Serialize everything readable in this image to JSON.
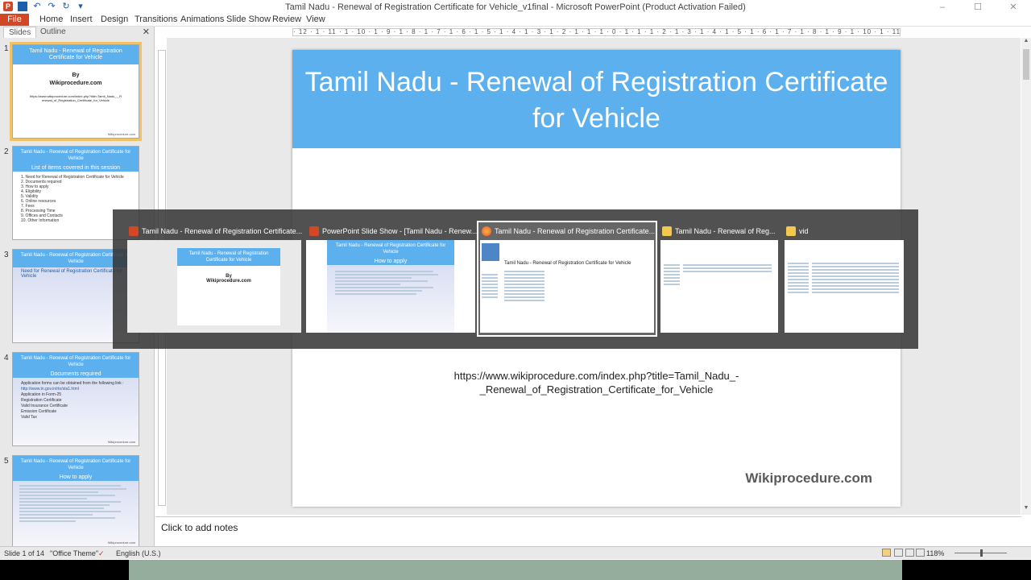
{
  "window": {
    "title": "Tamil Nadu - Renewal of Registration Certificate for Vehicle_v1final  -  Microsoft PowerPoint (Product Activation Failed)",
    "controls": {
      "minimize": "–",
      "maximize": "☐",
      "close": "✕"
    }
  },
  "ribbon": {
    "tabs": [
      "File",
      "Home",
      "Insert",
      "Design",
      "Transitions",
      "Animations",
      "Slide Show",
      "Review",
      "View"
    ],
    "accent_color": "#d24726"
  },
  "left_panel": {
    "tabs": [
      "Slides",
      "Outline"
    ],
    "close": "✕",
    "slides": [
      {
        "num": "1",
        "title": "Tamil Nadu - Renewal of Registration Certificate for Vehicle",
        "by": "By",
        "brand": "Wikiprocedure.com",
        "url": "https://www.wikiprocedure.com/index.php?title=Tamil_Nadu_-_Renewal_of_Registration_Certificate_for_Vehicle",
        "footer": "Wikiprocedure.com"
      },
      {
        "num": "2",
        "title": "Tamil Nadu - Renewal of Registration Certificate for Vehicle",
        "subtitle": "List of items covered in this session",
        "items": [
          "1. Need for Renewal of Registration Certificate for Vehicle",
          "2. Documents required",
          "3. How to apply",
          "4. Eligibility",
          "5. Validity",
          "6. Online resources",
          "7. Fees",
          "8. Processing Time",
          "9. Offices and Contacts",
          "10. Other Information"
        ]
      },
      {
        "num": "3",
        "title": "Tamil Nadu - Renewal of Registration Certificate for Vehicle",
        "subtitle": "Need for Renewal of Registration Certificate for Vehicle"
      },
      {
        "num": "4",
        "title": "Tamil Nadu - Renewal of Registration Certificate for Vehicle",
        "subtitle": "Documents required",
        "items": [
          "Application forms can be obtained from the following link :",
          "http://www.tn.gov.in/rto/sta1.html",
          "Application in Form-25",
          "Registration Certificate",
          "Valid Insurance Certificate",
          "Emission Certificate",
          "Valid Tax"
        ],
        "footer": "Wikiprocedure.com"
      },
      {
        "num": "5",
        "title": "Tamil Nadu - Renewal of Registration Certificate for Vehicle",
        "subtitle": "How to apply",
        "footer": "Wikiprocedure.com"
      }
    ]
  },
  "ruler": {
    "ticks": "· 12 · 1 · 11 · 1 · 10 · 1 · 9 · 1 · 8 · 1 · 7 · 1 · 6 · 1 · 5 · 1 · 4 · 1 · 3 · 1 · 2 · 1 · 1 · 1 · 0 · 1 · 1 · 1 · 2 · 1 · 3 · 1 · 4 · 1 · 5 · 1 · 6 · 1 · 7 · 1 · 8 · 1 · 9 · 1 · 10 · 1 · 11 · 1 · 12 ·"
  },
  "slide": {
    "title": "Tamil Nadu - Renewal of Registration Certificate for Vehicle",
    "url_line1": "https://www.wikiprocedure.com/index.php?title=Tamil_Nadu_-",
    "url_line2": "_Renewal_of_Registration_Certificate_for_Vehicle",
    "brand": "Wikiprocedure.com",
    "header_color": "#5db0ee"
  },
  "notes": {
    "placeholder": "Click to add notes"
  },
  "status_bar": {
    "slide_info": "Slide 1 of 14",
    "theme": "\"Office Theme\"",
    "language": "English (U.S.)",
    "zoom": "118%"
  },
  "alt_tab": {
    "windows": [
      {
        "title": "Tamil Nadu - Renewal of Registration Certificate...",
        "icon": "powerpoint-icon"
      },
      {
        "title": "PowerPoint Slide Show - [Tamil Nadu - Renew...",
        "icon": "powerpoint-icon"
      },
      {
        "title": "Tamil Nadu - Renewal of Registration Certificate...",
        "icon": "firefox-icon"
      },
      {
        "title": "Tamil Nadu - Renewal of Reg...",
        "icon": "folder-icon"
      },
      {
        "title": "vid",
        "icon": "folder-icon"
      }
    ],
    "preview_slide_title": "Tamil Nadu - Renewal of Registration Certificate for Vehicle",
    "preview_by": "By",
    "preview_brand": "Wikiprocedure.com",
    "preview_how_to_apply": "How to apply",
    "preview_web_title": "Tamil Nadu - Renewal of Registration Certificate for Vehicle"
  }
}
